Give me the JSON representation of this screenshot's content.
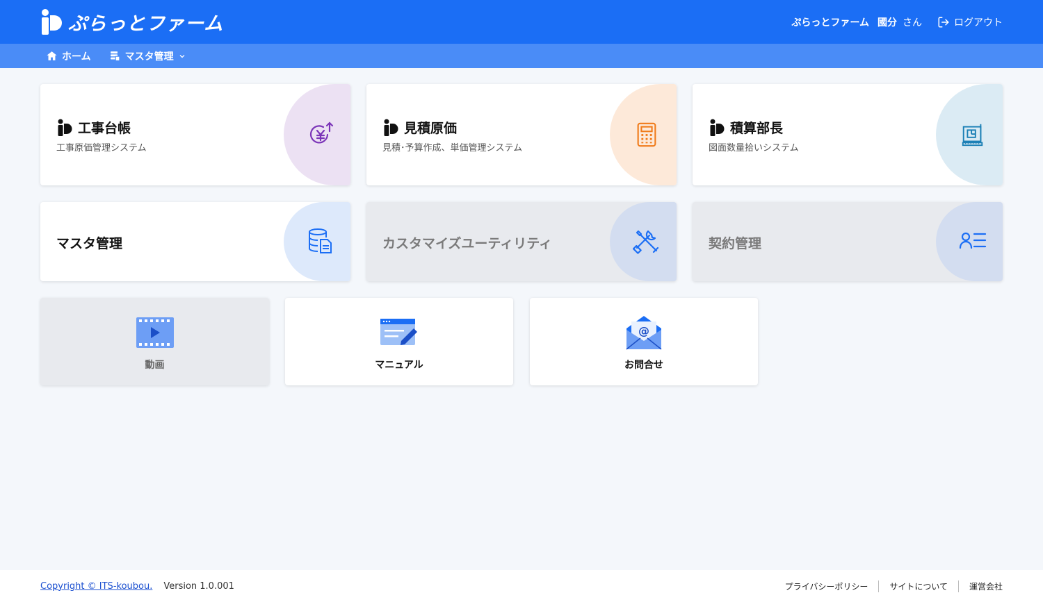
{
  "header": {
    "logo_text": "ぷらっとファーム",
    "company": "ぷらっとファーム",
    "user_name": "國分",
    "user_suffix": "さん",
    "logout_label": "ログアウト",
    "bg_color": "#1b6ef5"
  },
  "nav": {
    "home_label": "ホーム",
    "master_label": "マスタ管理"
  },
  "cards": {
    "koji": {
      "title": "工事台帳",
      "subtitle": "工事原価管理システム",
      "icon": "yen-up-icon",
      "color": "#ece1f3"
    },
    "mitsumori": {
      "title": "見積原価",
      "subtitle": "見積･予算作成、単価管理システム",
      "icon": "calculator-icon",
      "color": "#fde9d9"
    },
    "sekisan": {
      "title": "積算部長",
      "subtitle": "図面数量拾いシステム",
      "icon": "blueprint-icon",
      "color": "#dbebf4"
    },
    "master": {
      "title": "マスタ管理",
      "icon": "database-doc-icon",
      "color": "#dde9fb"
    },
    "custom": {
      "title": "カスタマイズユーティリティ",
      "icon": "tools-icon",
      "color": "#d3ddf0"
    },
    "keiyaku": {
      "title": "契約管理",
      "icon": "user-list-icon",
      "color": "#d3ddf0"
    }
  },
  "small_cards": {
    "video": {
      "label": "動画",
      "icon": "video-icon"
    },
    "manual": {
      "label": "マニュアル",
      "icon": "manual-edit-icon"
    },
    "contact": {
      "label": "お問合せ",
      "icon": "mail-at-icon"
    }
  },
  "footer": {
    "copyright": "Copyright © ITS-koubou.",
    "version": "Version 1.0.001",
    "links": [
      "プライバシーポリシー",
      "サイトについて",
      "運営会社"
    ]
  }
}
